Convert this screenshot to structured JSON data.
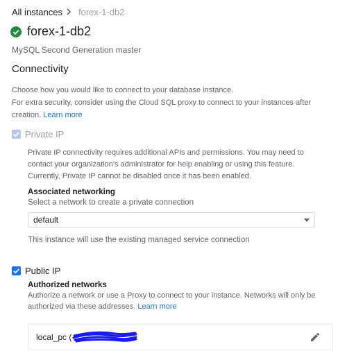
{
  "breadcrumb": {
    "parent_label": "All instances",
    "separator_icon": "chevron-right-icon",
    "current_label": "forex-1-db2"
  },
  "instance": {
    "status_icon": "check-circle-icon",
    "status_color": "#1e8e3e",
    "name": "forex-1-db2",
    "type": "MySQL Second Generation master"
  },
  "connectivity": {
    "section_title": "Connectivity",
    "description_1": "Choose how you would like to connect to your database instance.",
    "description_2": "For extra security, consider using the Cloud SQL proxy to connect to your instances after creation.",
    "learn_more_label": "Learn more",
    "private_ip": {
      "label": "Private IP",
      "checked": true,
      "disabled": true,
      "description": "Private IP connectivity requires additional APIs and permissions. You may need to contact your organization's administrator for help enabling or using this feature. Currently, Private IP cannot be disabled once it has been enabled.",
      "networking_label": "Associated networking",
      "networking_help": "Select a network to create a private connection",
      "network_value": "default",
      "network_note": "This instance will use the existing managed service connection"
    },
    "public_ip": {
      "label": "Public IP",
      "checked": true,
      "authorized_label": "Authorized networks",
      "authorized_help": "Authorize a network or use a Proxy to connect to your instance. Networks will only be authorized via these addresses.",
      "learn_more_label": "Learn more",
      "networks": [
        {
          "name": "local_pc (",
          "redacted": true,
          "edit_icon": "pencil-icon"
        }
      ]
    }
  },
  "colors": {
    "accent": "#1a73e8",
    "text_primary": "#202124",
    "text_secondary": "#5f6368",
    "redaction": "#1a1aff"
  }
}
